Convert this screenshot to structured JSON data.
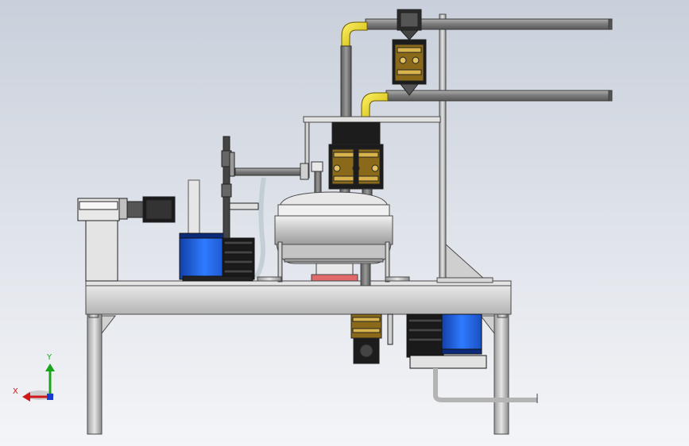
{
  "viewport": {
    "background_top": "#c9d0db",
    "background_bottom": "#f4f5f8"
  },
  "colors": {
    "frame_steel": "#c8c8c8",
    "frame_edge": "#4a4a4a",
    "pipe_gray": "#8a8a8a",
    "elbow_yellow": "#f2e21a",
    "motor_blue": "#1f5fd6",
    "motor_black": "#1a1a1a",
    "valve_brass": "#8a6a1a",
    "tank_steel": "#d6d6d6",
    "base_pink": "#e06a6a"
  },
  "axis_triad": {
    "y_label": "Y",
    "x_label": "X",
    "y_color": "#1aa61a",
    "x_color": "#d01a1a",
    "z_color": "#1a3ad0"
  }
}
